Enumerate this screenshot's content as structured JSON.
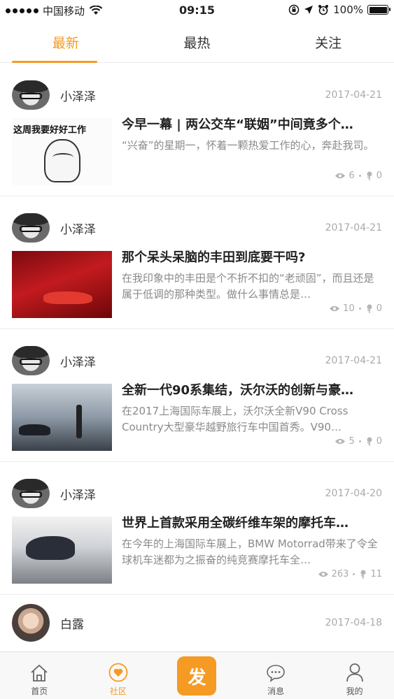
{
  "status_bar": {
    "carrier": "中国移动",
    "time": "09:15",
    "battery": "100%"
  },
  "tabs": [
    {
      "label": "最新",
      "active": true
    },
    {
      "label": "最热",
      "active": false
    },
    {
      "label": "关注",
      "active": false
    }
  ],
  "posts": [
    {
      "author": "小泽泽",
      "date": "2017-04-21",
      "thumb_caption": "这周我要好好工作",
      "title": "今早一幕 | 两公交车“联姻”中间竟多个…",
      "summary": "“兴奋”的星期一，怀着一颗热爱工作的心，奔赴我司。",
      "views": "6",
      "likes": "0"
    },
    {
      "author": "小泽泽",
      "date": "2017-04-21",
      "title": "那个呆头呆脑的丰田到底要干吗?",
      "summary": "在我印象中的丰田是个不折不扣的“老顽固”，而且还是属于低调的那种类型。做什么事情总是…",
      "views": "10",
      "likes": "0"
    },
    {
      "author": "小泽泽",
      "date": "2017-04-21",
      "title": "全新一代90系集结，沃尔沃的创新与豪…",
      "summary": "在2017上海国际车展上，沃尔沃全新V90 Cross Country大型豪华越野旅行车中国首秀。V90…",
      "views": "5",
      "likes": "0"
    },
    {
      "author": "小泽泽",
      "date": "2017-04-20",
      "title": "世界上首款采用全碳纤维车架的摩托车…",
      "summary": "在今年的上海国际车展上，BMW Motorrad带来了令全球机车迷都为之振奋的纯竞赛摩托车全…",
      "views": "263",
      "likes": "11"
    },
    {
      "author": "白露",
      "date": "2017-04-18"
    }
  ],
  "bottom_nav": {
    "home": "首页",
    "community": "社区",
    "post": "发",
    "messages": "消息",
    "mine": "我的"
  },
  "colors": {
    "accent": "#f59a23"
  }
}
